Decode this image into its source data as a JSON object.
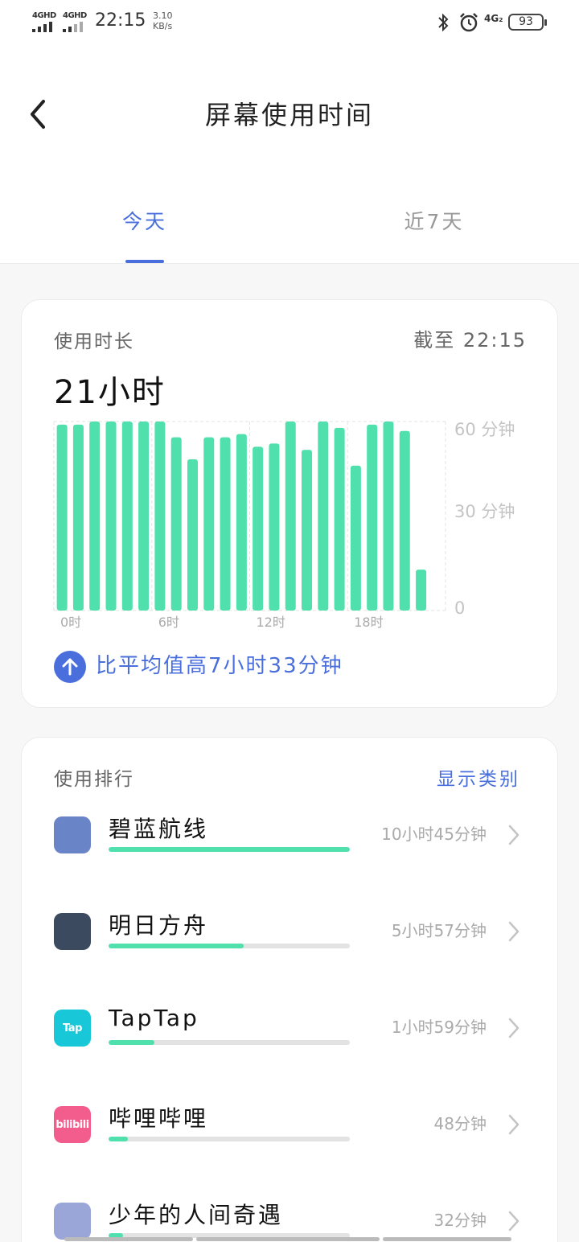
{
  "status_bar": {
    "net1": "4GHD",
    "net2": "4GHD",
    "time": "22:15",
    "speed_value": "3.10",
    "speed_unit": "KB/s",
    "net3": "4G₂",
    "battery": "93"
  },
  "header": {
    "title": "屏幕使用时间",
    "back_icon": "chevron-left-icon"
  },
  "tabs": [
    {
      "label": "今天",
      "active": true
    },
    {
      "label": "近7天",
      "active": false
    }
  ],
  "usage": {
    "label": "使用时长",
    "as_of": "截至 22:15",
    "total": "21小时",
    "compare_text": "比平均值高7小时33分钟",
    "compare_icon": "arrow-up-icon"
  },
  "chart_data": {
    "type": "bar",
    "categories": [
      "0",
      "1",
      "2",
      "3",
      "4",
      "5",
      "6",
      "7",
      "8",
      "9",
      "10",
      "11",
      "12",
      "13",
      "14",
      "15",
      "16",
      "17",
      "18",
      "19",
      "20",
      "21",
      "22"
    ],
    "values": [
      59,
      59,
      60,
      60,
      60,
      60,
      60,
      55,
      48,
      55,
      55,
      56,
      52,
      53,
      60,
      51,
      60,
      58,
      46,
      59,
      60,
      57,
      13
    ],
    "x_tick_labels": [
      "0时",
      "6时",
      "12时",
      "18时"
    ],
    "y_tick_labels": [
      "60 分钟",
      "30 分钟",
      "0"
    ],
    "ylim": [
      0,
      60
    ],
    "bar_color": "#4fe0ad",
    "grid": true
  },
  "ranking": {
    "label": "使用排行",
    "link": "显示类别",
    "apps": [
      {
        "name": "碧蓝航线",
        "duration": "10小时45分钟",
        "fraction": 1.0,
        "icon": "azur-lane-icon",
        "icon_color": "#6a84c8"
      },
      {
        "name": "明日方舟",
        "duration": "5小时57分钟",
        "fraction": 0.56,
        "icon": "arknights-icon",
        "icon_color": "#3b4a5e"
      },
      {
        "name": "TapTap",
        "duration": "1小时59分钟",
        "fraction": 0.19,
        "icon": "taptap-icon",
        "icon_color": "#18c8d8",
        "icon_text": "Tap"
      },
      {
        "name": "哔哩哔哩",
        "duration": "48分钟",
        "fraction": 0.08,
        "icon": "bilibili-icon",
        "icon_color": "#f25d8e",
        "icon_text": "bilibili"
      },
      {
        "name": "少年的人间奇遇",
        "duration": "32分钟",
        "fraction": 0.06,
        "icon": "shaonian-game-icon",
        "icon_color": "#9aa6d8"
      }
    ]
  }
}
